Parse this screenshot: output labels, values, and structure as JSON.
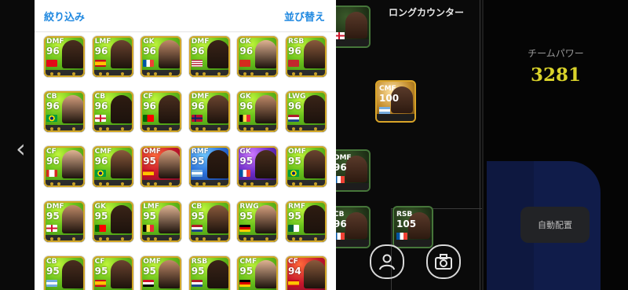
{
  "panel": {
    "filter_label": "絞り込み",
    "sort_label": "並び替え"
  },
  "formation": {
    "title": "ロングカウンター",
    "team_power_label": "チームパワー",
    "team_power_value": "3281",
    "auto_button_label": "自動配置",
    "cards": [
      {
        "pos": "",
        "rating": "",
        "flag": "england"
      },
      {
        "pos": "CMF",
        "rating": "100",
        "flag": "argentina"
      },
      {
        "pos": "DMF",
        "rating": "96",
        "flag": "france"
      },
      {
        "pos": "CB",
        "rating": "96",
        "flag": "france"
      },
      {
        "pos": "RSB",
        "rating": "105",
        "flag": "france"
      }
    ]
  },
  "players": [
    {
      "pos": "DMF",
      "rating": "96",
      "flag": "turkey",
      "card": "green"
    },
    {
      "pos": "LMF",
      "rating": "96",
      "flag": "spain",
      "card": "green"
    },
    {
      "pos": "GK",
      "rating": "96",
      "flag": "france",
      "card": "green"
    },
    {
      "pos": "DMF",
      "rating": "96",
      "flag": "usa",
      "card": "green"
    },
    {
      "pos": "GK",
      "rating": "96",
      "flag": "switzerland",
      "card": "green"
    },
    {
      "pos": "RSB",
      "rating": "96",
      "flag": "morocco",
      "card": "green"
    },
    {
      "pos": "CB",
      "rating": "96",
      "flag": "brazil",
      "card": "green"
    },
    {
      "pos": "CB",
      "rating": "96",
      "flag": "england",
      "card": "green"
    },
    {
      "pos": "CF",
      "rating": "96",
      "flag": "portugal",
      "card": "green"
    },
    {
      "pos": "DMF",
      "rating": "96",
      "flag": "norway",
      "card": "green"
    },
    {
      "pos": "GK",
      "rating": "96",
      "flag": "belgium",
      "card": "green"
    },
    {
      "pos": "LWG",
      "rating": "96",
      "flag": "netherlands",
      "card": "green"
    },
    {
      "pos": "CF",
      "rating": "96",
      "flag": "canada",
      "card": "green"
    },
    {
      "pos": "CMF",
      "rating": "96",
      "flag": "brazil",
      "card": "green"
    },
    {
      "pos": "OMF",
      "rating": "95",
      "flag": "spain",
      "card": "red"
    },
    {
      "pos": "RMF",
      "rating": "95",
      "flag": "argentina",
      "card": "blue"
    },
    {
      "pos": "GK",
      "rating": "95",
      "flag": "france",
      "card": "purple"
    },
    {
      "pos": "OMF",
      "rating": "95",
      "flag": "brazil",
      "card": "green"
    },
    {
      "pos": "DMF",
      "rating": "95",
      "flag": "england",
      "card": "green"
    },
    {
      "pos": "GK",
      "rating": "95",
      "flag": "portugal",
      "card": "green"
    },
    {
      "pos": "LMF",
      "rating": "95",
      "flag": "belgium",
      "card": "green"
    },
    {
      "pos": "CB",
      "rating": "95",
      "flag": "netherlands",
      "card": "green"
    },
    {
      "pos": "RWG",
      "rating": "95",
      "flag": "germany",
      "card": "green"
    },
    {
      "pos": "RMF",
      "rating": "95",
      "flag": "algeria",
      "card": "green"
    },
    {
      "pos": "CB",
      "rating": "95",
      "flag": "argentina",
      "card": "green"
    },
    {
      "pos": "CF",
      "rating": "95",
      "flag": "spain",
      "card": "green"
    },
    {
      "pos": "OMF",
      "rating": "95",
      "flag": "egypt",
      "card": "green"
    },
    {
      "pos": "RSB",
      "rating": "95",
      "flag": "netherlands",
      "card": "green"
    },
    {
      "pos": "CMF",
      "rating": "95",
      "flag": "germany",
      "card": "green"
    },
    {
      "pos": "CF",
      "rating": "94",
      "flag": "spain",
      "card": "red"
    }
  ]
}
